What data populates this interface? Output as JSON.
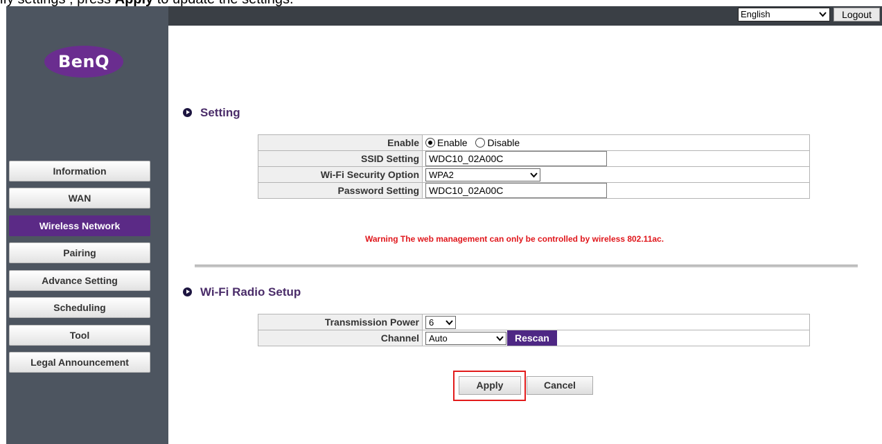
{
  "caption": {
    "text_before": "ify settings",
    "text_after": "    , press",
    "bold": "Apply",
    "text_end": " to update the settings."
  },
  "header": {
    "language": "English",
    "logout_label": "Logout"
  },
  "brand": {
    "logo_text": "BenQ"
  },
  "sidebar": {
    "items": [
      {
        "label": "Information"
      },
      {
        "label": "WAN"
      },
      {
        "label": "Wireless Network"
      },
      {
        "label": "Pairing"
      },
      {
        "label": "Advance Setting"
      },
      {
        "label": "Scheduling"
      },
      {
        "label": "Tool"
      },
      {
        "label": "Legal Announcement"
      }
    ],
    "active": "Wireless Network"
  },
  "setting": {
    "title": "Setting",
    "enable_label": "Enable",
    "enable_option": "Enable",
    "disable_option": "Disable",
    "enable_selected": "Enable",
    "ssid_label": "SSID Setting",
    "ssid_value": "WDC10_02A00C",
    "security_label": "Wi-Fi Security Option",
    "security_value": "WPA2",
    "password_label": "Password Setting",
    "password_value": "WDC10_02A00C"
  },
  "warning": {
    "prefix": "Warning",
    "message": "The web management can only be controlled by wireless 802.11ac."
  },
  "radio_setup": {
    "title": "Wi-Fi Radio Setup",
    "power_label": "Transmission Power",
    "power_value": "6",
    "channel_label": "Channel",
    "channel_value": "Auto",
    "rescan_label": "Rescan"
  },
  "actions": {
    "apply_label": "Apply",
    "cancel_label": "Cancel"
  },
  "colors": {
    "accent": "#5b2a86",
    "sidebar": "#4d5560",
    "topbar": "#3a3f45",
    "warning": "#e0161b",
    "highlight": "#e21b1b"
  }
}
